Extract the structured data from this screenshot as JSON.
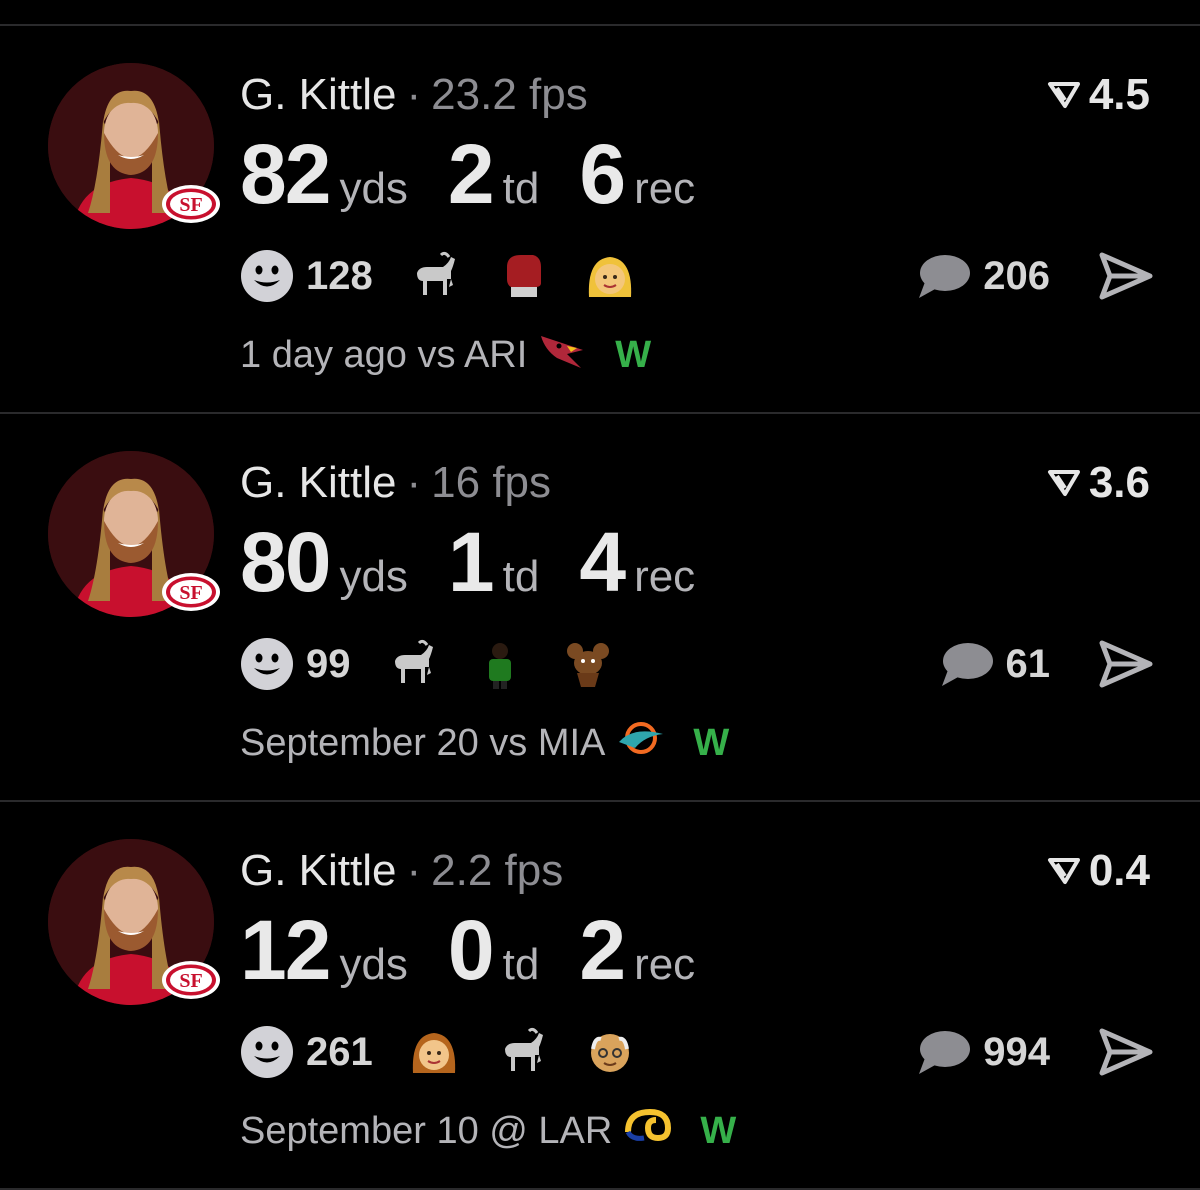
{
  "posts": [
    {
      "player": "G. Kittle",
      "fps": "23.2 fps",
      "boost": "4.5",
      "stats": [
        {
          "value": "82",
          "unit": "yds"
        },
        {
          "value": "2",
          "unit": "td"
        },
        {
          "value": "6",
          "unit": "rec"
        }
      ],
      "reaction_count": "128",
      "reaction_emojis": [
        "goat-emoji",
        "boxing-glove-emoji",
        "blonde-woman-emoji"
      ],
      "comment_count": "206",
      "when": "1 day ago",
      "matchup": "vs ARI",
      "opponent_logo": "cardinals-logo",
      "result": "W"
    },
    {
      "player": "G. Kittle",
      "fps": "16 fps",
      "boost": "3.6",
      "stats": [
        {
          "value": "80",
          "unit": "yds"
        },
        {
          "value": "1",
          "unit": "td"
        },
        {
          "value": "4",
          "unit": "rec"
        }
      ],
      "reaction_count": "99",
      "reaction_emojis": [
        "goat-emoji",
        "player-sticker",
        "cartoon-mouse-sticker"
      ],
      "comment_count": "61",
      "when": "September 20",
      "matchup": "vs MIA",
      "opponent_logo": "dolphins-logo",
      "result": "W"
    },
    {
      "player": "G. Kittle",
      "fps": "2.2 fps",
      "boost": "0.4",
      "stats": [
        {
          "value": "12",
          "unit": "yds"
        },
        {
          "value": "0",
          "unit": "td"
        },
        {
          "value": "2",
          "unit": "rec"
        }
      ],
      "reaction_count": "261",
      "reaction_emojis": [
        "woman-emoji",
        "goat-emoji",
        "old-man-emoji"
      ],
      "comment_count": "994",
      "when": "September 10",
      "matchup": "@ LAR",
      "opponent_logo": "rams-logo",
      "result": "W"
    }
  ],
  "colors": {
    "background": "#000000",
    "divider": "#2a2a2c",
    "win": "#36b04a",
    "muted": "#8d8d92",
    "team": "#c8102e"
  }
}
